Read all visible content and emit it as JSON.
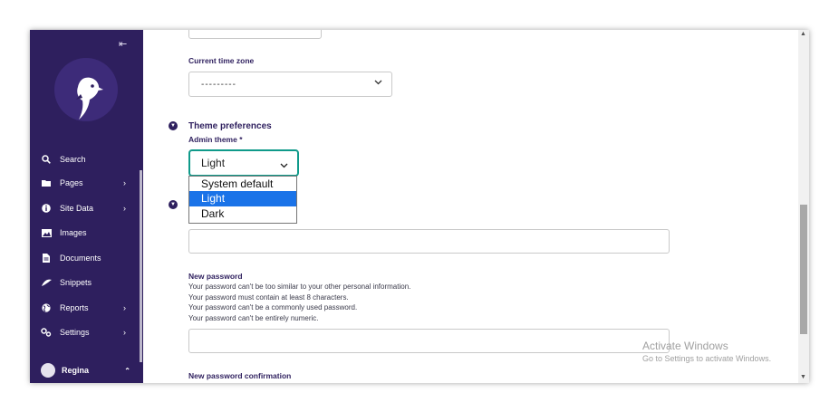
{
  "sidebar": {
    "collapse_icon": "collapse-sidebar-icon",
    "items": [
      {
        "label": "Search",
        "icon": "search-icon",
        "has_chevron": false
      },
      {
        "label": "Pages",
        "icon": "folder-icon",
        "has_chevron": true
      },
      {
        "label": "Site Data",
        "icon": "info-icon",
        "has_chevron": true
      },
      {
        "label": "Images",
        "icon": "image-icon",
        "has_chevron": false
      },
      {
        "label": "Documents",
        "icon": "document-icon",
        "has_chevron": false
      },
      {
        "label": "Snippets",
        "icon": "snippet-icon",
        "has_chevron": false
      },
      {
        "label": "Reports",
        "icon": "globe-icon",
        "has_chevron": true
      },
      {
        "label": "Settings",
        "icon": "cogs-icon",
        "has_chevron": true
      }
    ],
    "user": {
      "name": "Regina",
      "toggle_icon": "chevron-up-icon"
    }
  },
  "form": {
    "timezone": {
      "label": "Current time zone",
      "value": "---------"
    },
    "theme_section": {
      "title": "Theme preferences"
    },
    "admin_theme": {
      "label": "Admin theme *",
      "value": "Light",
      "options": [
        "System default",
        "Light",
        "Dark"
      ],
      "selected_index": 1
    },
    "new_password": {
      "label": "New password",
      "help": [
        "Your password can't be too similar to your other personal information.",
        "Your password must contain at least 8 characters.",
        "Your password can't be a commonly used password.",
        "Your password can't be entirely numeric."
      ]
    },
    "new_password_confirmation": {
      "label": "New password confirmation"
    }
  },
  "watermark": {
    "line1": "Activate Windows",
    "line2": "Go to Settings to activate Windows."
  },
  "colors": {
    "sidebar": "#2e1f5e",
    "accent": "#0f9a8a",
    "selected_option": "#1a73e8"
  }
}
